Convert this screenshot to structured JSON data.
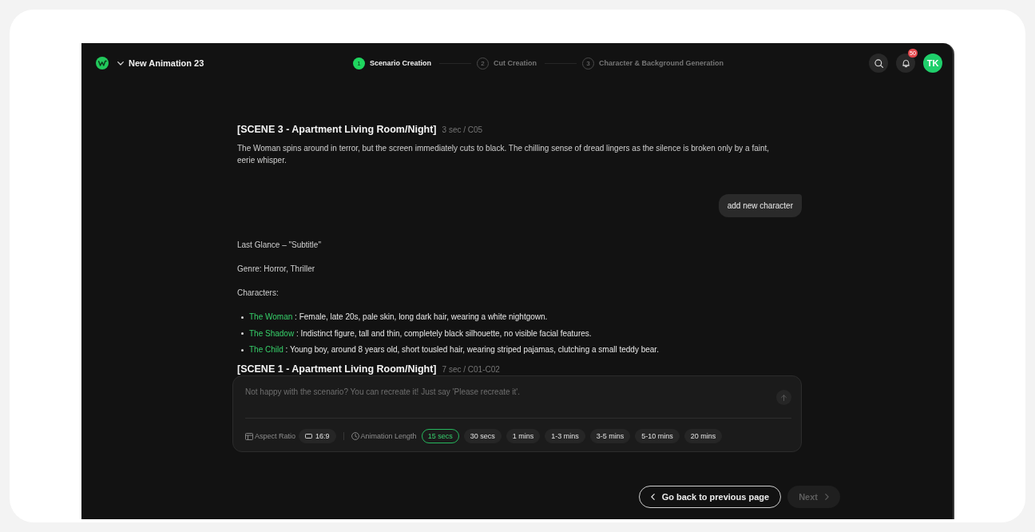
{
  "header": {
    "project_title": "New Animation 23",
    "steps": [
      {
        "number": "1",
        "label": "Scenario Creation",
        "selected": true
      },
      {
        "number": "2",
        "label": "Cut Creation",
        "selected": false
      },
      {
        "number": "3",
        "label": "Character & Background Generation",
        "selected": false
      }
    ],
    "notification_count": "50",
    "avatar_initials": "TK"
  },
  "conversation": {
    "scene": {
      "heading": "[SCENE 3 - Apartment Living Room/Night]",
      "meta": "3 sec / C05",
      "description": "The Woman spins around in terror, but the screen immediately cuts to black. The chilling sense of dread lingers as the silence is broken only by a faint, eerie whisper."
    },
    "user_message": "add new character",
    "script": {
      "title": "Last Glance – \"Subtitle\"",
      "genre": "Genre: Horror, Thriller",
      "characters_label": "Characters:",
      "characters": [
        {
          "name": "The Woman",
          "description": ": Female, late 20s, pale skin, long dark hair, wearing a white nightgown."
        },
        {
          "name": "The Shadow",
          "description": ": Indistinct figure, tall and thin, completely black silhouette, no visible facial features."
        },
        {
          "name": "The Child",
          "description": ": Young boy, around 8 years old, short tousled hair, wearing striped pajamas, clutching a small teddy bear."
        }
      ],
      "next_scene": {
        "heading": "[SCENE 1 - Apartment Living Room/Night]",
        "meta": "7 sec / C01-C02"
      }
    }
  },
  "composer": {
    "placeholder": "Not happy with the scenario? You can recreate it! Just say 'Please recreate it'.",
    "aspect_ratio": {
      "label": "Aspect Ratio",
      "value": "16:9"
    },
    "animation_length": {
      "label": "Animation Length",
      "options": [
        {
          "label": "15 secs",
          "selected": true
        },
        {
          "label": "30 secs",
          "selected": false
        },
        {
          "label": "1 mins",
          "selected": false
        },
        {
          "label": "1-3 mins",
          "selected": false
        },
        {
          "label": "3-5 mins",
          "selected": false
        },
        {
          "label": "5-10 mins",
          "selected": false
        },
        {
          "label": "20 mins",
          "selected": false
        }
      ]
    }
  },
  "footer": {
    "back_button": "Go back to previous page",
    "next_button": {
      "label": "Next",
      "disabled": true
    }
  }
}
